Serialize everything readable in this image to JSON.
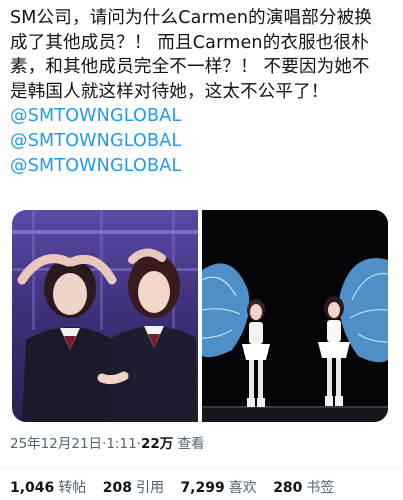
{
  "post": {
    "lines": [
      "SM公司，请问为什么Carmen的演唱部分被换",
      "成了其他成员？！ 而且Carmen的衣服也很朴",
      "素，和其他成员完全不一样？！ 不要因为她不",
      "是韩国人就这样对待她，这太不公平了！"
    ],
    "mentions": [
      "@SMTOWNGLOBAL",
      "@SMTOWNGLOBAL",
      "@SMTOWNGLOBAL"
    ]
  },
  "meta": {
    "date": "25年12月21日",
    "separator1": "·",
    "time": "1:11",
    "separator2": "·",
    "views_count": "22万",
    "views_label": "查看"
  },
  "stats": {
    "reposts": {
      "count": "1,046",
      "label": "转帖"
    },
    "quotes": {
      "count": "208",
      "label": "引用"
    },
    "likes": {
      "count": "7,299",
      "label": "喜欢"
    },
    "bookmarks": {
      "count": "280",
      "label": "书签"
    }
  },
  "colors": {
    "mention": "#1d9bf0",
    "text": "#0f1419",
    "secondary": "#536471",
    "left_photo_bg": "#4a3a8a",
    "right_photo_bg": "#050508",
    "wing_blue": "#5aa8e8"
  }
}
